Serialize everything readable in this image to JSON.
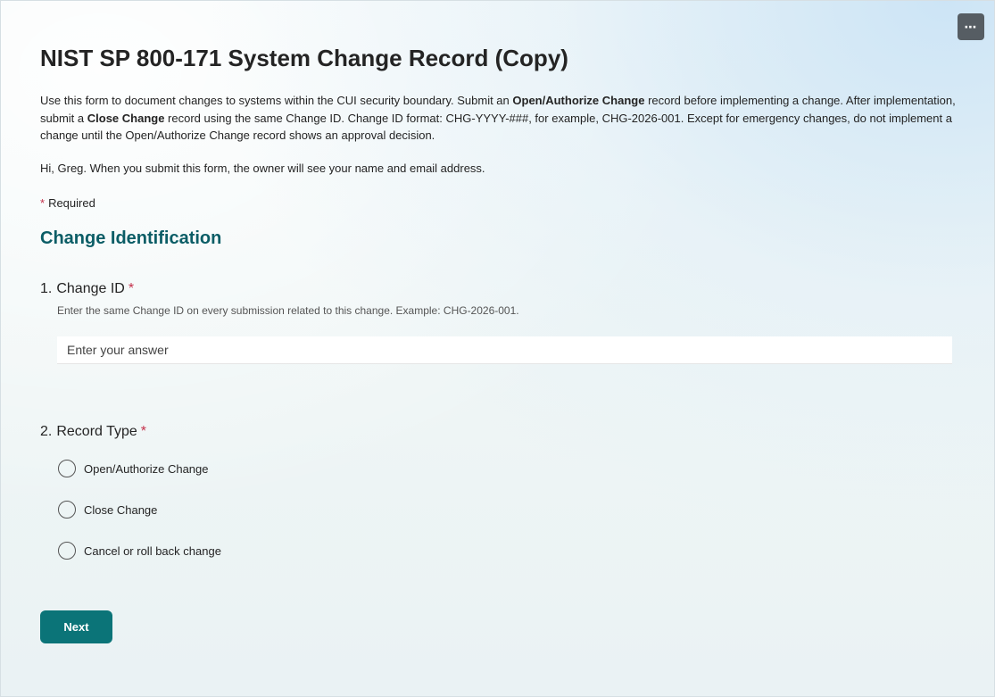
{
  "header": {
    "more_label": "⋯",
    "more_icon": "ellipsis-icon"
  },
  "form": {
    "title": "NIST SP 800-171 System Change Record (Copy)",
    "description": {
      "p1": "Use this form to document changes to systems within the CUI security boundary. Submit an ",
      "b1": "Open/Authorize Change",
      "p2": " record before implementing a change. After implementation, submit a ",
      "b2": "Close Change",
      "p3": " record using the same Change ID. Change ID format: CHG-YYYY-###, for example, CHG-2026-001. Except for emergency changes, do not implement a change until the Open/Authorize Change record shows an approval decision."
    },
    "greeting": "Hi, Greg. When you submit this form, the owner will see your name and email address.",
    "required_star": "*",
    "required_label": "Required",
    "section_title": "Change Identification",
    "questions": [
      {
        "number": "1.",
        "label": "Change ID",
        "star": "*",
        "subtitle": "Enter the same Change ID on every submission related to this change. Example: CHG-2026-001.",
        "placeholder": "Enter your answer",
        "value": ""
      },
      {
        "number": "2.",
        "label": "Record Type",
        "star": "*",
        "options": [
          "Open/Authorize Change",
          "Close Change",
          "Cancel or roll back change"
        ]
      }
    ],
    "next_label": "Next",
    "accent_color": "#0b7478",
    "required_color": "#c4314b"
  }
}
